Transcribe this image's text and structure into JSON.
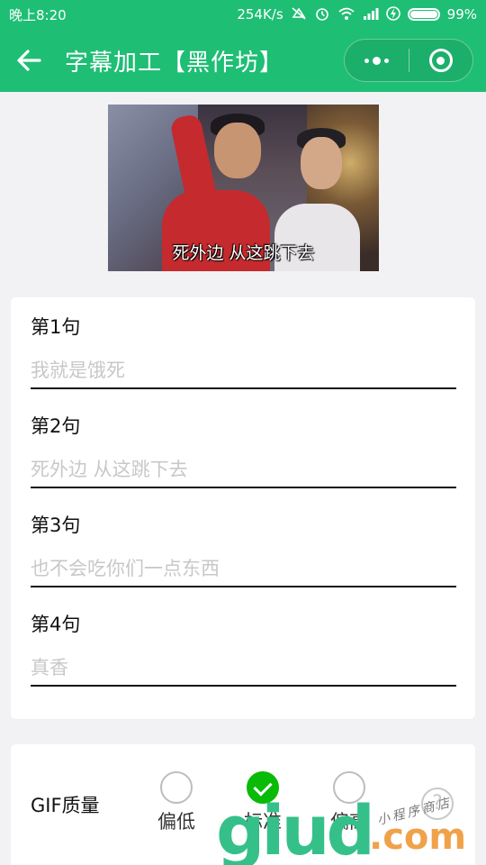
{
  "status_bar": {
    "time": "晚上8:20",
    "network_speed": "254K/s",
    "battery_percent": "99%",
    "icons": [
      "mute-icon",
      "alarm-icon",
      "wifi-icon",
      "signal-icon",
      "charging-icon",
      "battery-icon"
    ]
  },
  "nav": {
    "title": "字幕加工【黑作坊】",
    "back_icon": "arrow-left-icon",
    "more_icon": "more-dots-icon",
    "close_icon": "target-circle-icon",
    "background": "#1fbe75"
  },
  "preview": {
    "subtitle": "死外边 从这跳下去"
  },
  "sentences": [
    {
      "label": "第1句",
      "placeholder": "我就是饿死"
    },
    {
      "label": "第2句",
      "placeholder": "死外边 从这跳下去"
    },
    {
      "label": "第3句",
      "placeholder": "也不会吃你们一点东西"
    },
    {
      "label": "第4句",
      "placeholder": "真香"
    }
  ],
  "quality": {
    "label": "GIF质量",
    "options": [
      {
        "label": "偏低",
        "checked": false
      },
      {
        "label": "标准",
        "checked": true
      },
      {
        "label": "偏高",
        "checked": false
      }
    ],
    "help": "?",
    "accent": "#09bb07"
  },
  "watermark": {
    "main": "giud",
    "domain": ".com",
    "tagline": "小程序商店"
  }
}
